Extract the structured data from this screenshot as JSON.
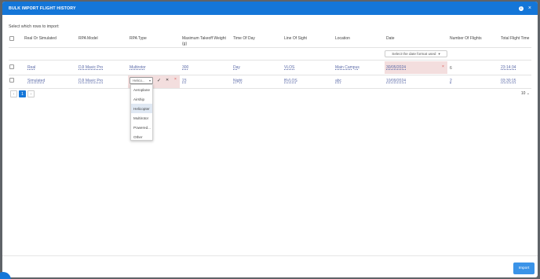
{
  "modal": {
    "title": "BULK IMPORT FLIGHT HISTORY",
    "info_icon": "i",
    "close_icon": "×",
    "subtitle": "Select which rows to import:"
  },
  "columns": [
    "Real Or Simulated",
    "RPA Model",
    "RPA Type",
    "Maximum Takeoff Weight (g)",
    "Time Of Day",
    "Line Of Sight",
    "Location",
    "Date",
    "Number Of Flights",
    "Total Flight Time"
  ],
  "date_filter": {
    "label": "Select the date format used",
    "icon": "chevron-down-icon"
  },
  "rows": [
    {
      "real_or_simulated": "Real",
      "rpa_model": "DJI Mavic Pro",
      "rpa_type": "Multirotor",
      "mtow": "300",
      "time_of_day": "Day",
      "line_of_sight": "VLOS",
      "location": "Main Campus",
      "date": "30/05/2024",
      "flights": "6",
      "total_time": "23:14:34"
    },
    {
      "real_or_simulated": "Simulated",
      "rpa_model": "DJI Mavic Pro",
      "rpa_type": "Helicopter",
      "mtow": "23",
      "time_of_day": "Night",
      "line_of_sight": "BVLOS",
      "location": "abc",
      "date": "10/09/2024",
      "flights": "2",
      "total_time": "03:30:15"
    }
  ],
  "edit": {
    "select_value": "Helico...",
    "confirm": "✓",
    "cancel": "✕",
    "error_mark": "×",
    "options": [
      "Aeroplane",
      "Airship",
      "Helicopter",
      "Multirotor",
      "Powered...",
      "Other"
    ],
    "highlighted": "Helicopter"
  },
  "pagination": {
    "prev": "‹",
    "current": "1",
    "next": "›",
    "page_size": "10"
  },
  "footer": {
    "import_label": "Import"
  },
  "colors": {
    "header": "#1476d8",
    "error_bg": "#f3dede",
    "link": "#5b6aa8",
    "button": "#3a93e8"
  }
}
